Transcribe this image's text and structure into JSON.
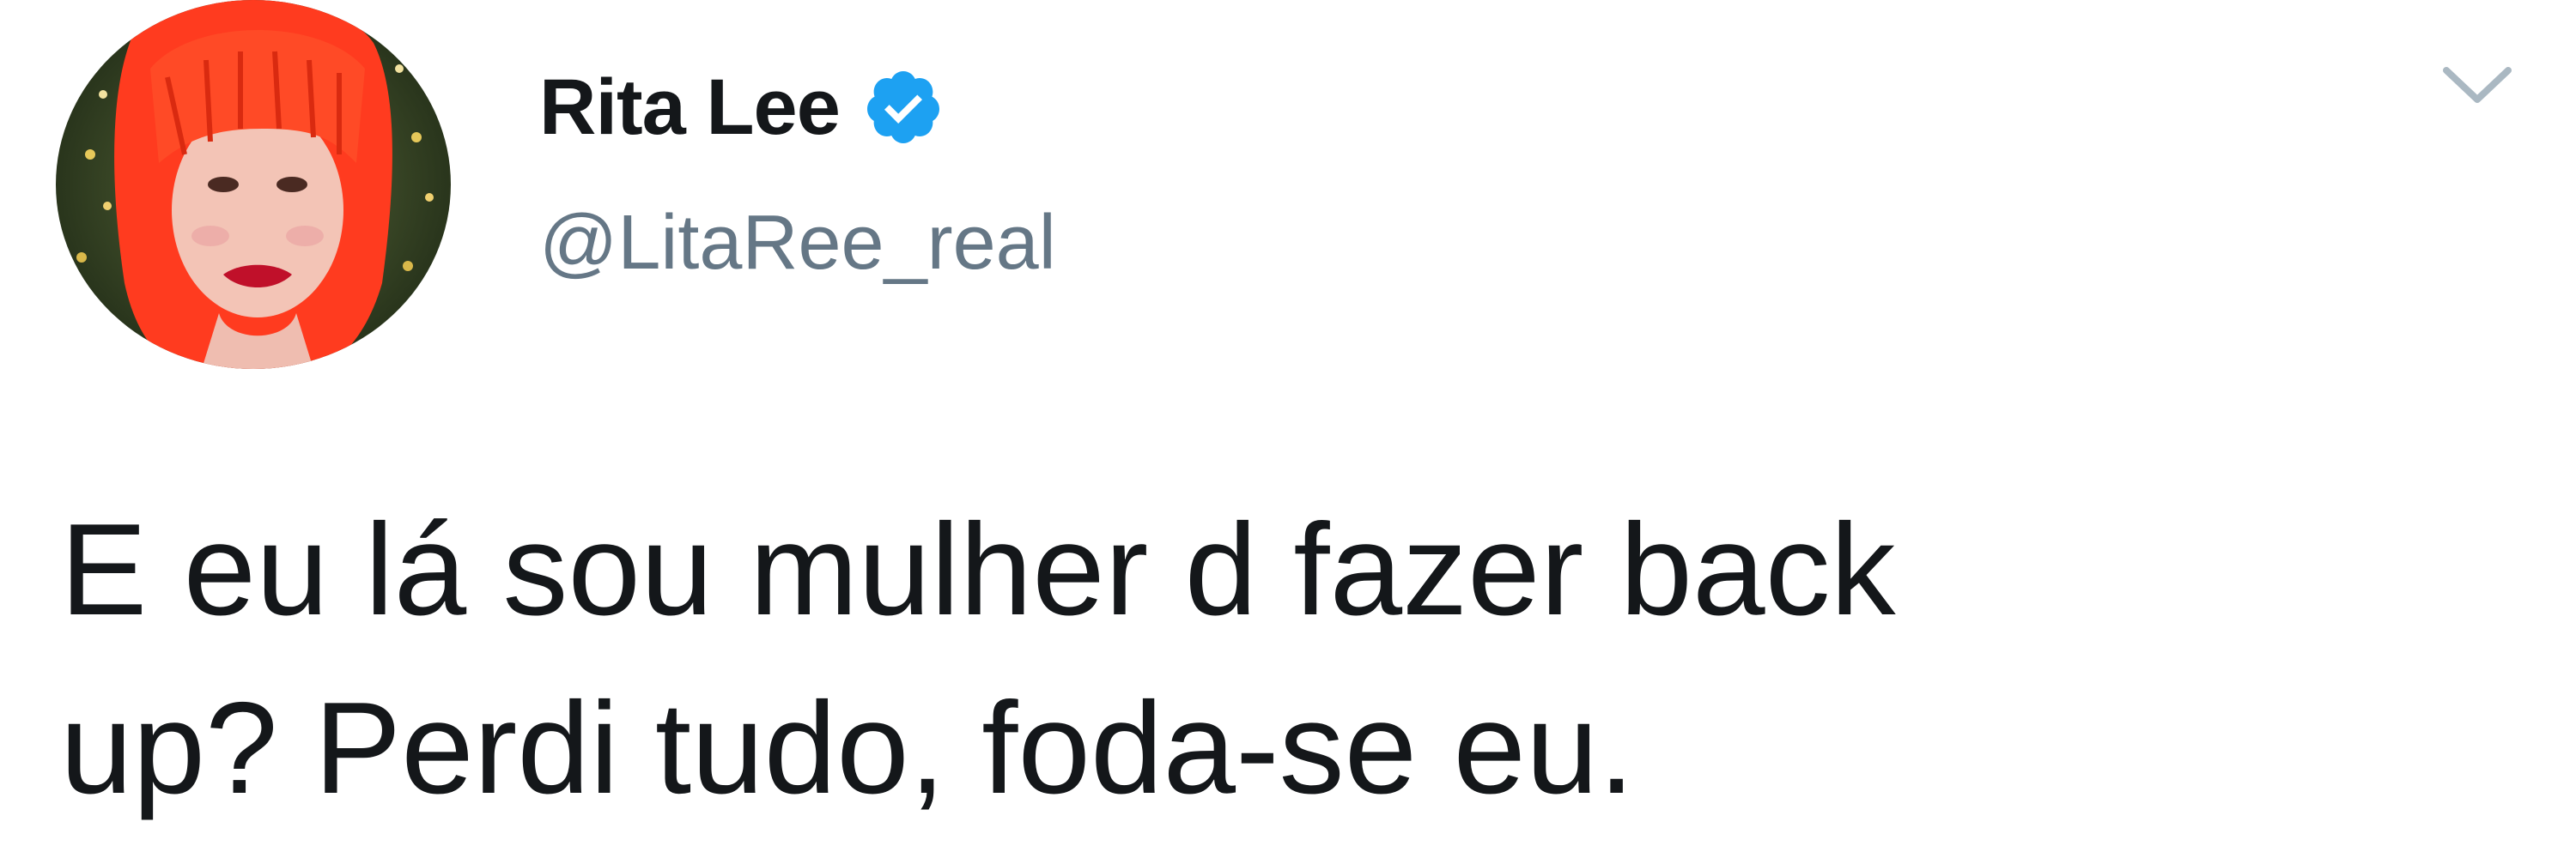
{
  "tweet": {
    "author": {
      "name": "Rita Lee",
      "handle": "@LitaRee_real",
      "verified": true,
      "avatar_icon": "profile-photo-red-hair"
    },
    "menu_icon": "chevron-down-icon",
    "text_lines": [
      "E eu lá sou mulher d fazer back",
      "up? Perdi tudo, foda-se eu."
    ]
  },
  "colors": {
    "background": "#ffffff",
    "name_text": "#14171a",
    "handle_text": "#657786",
    "verified_badge": "#1da1f2",
    "caret": "#aab8c2"
  }
}
